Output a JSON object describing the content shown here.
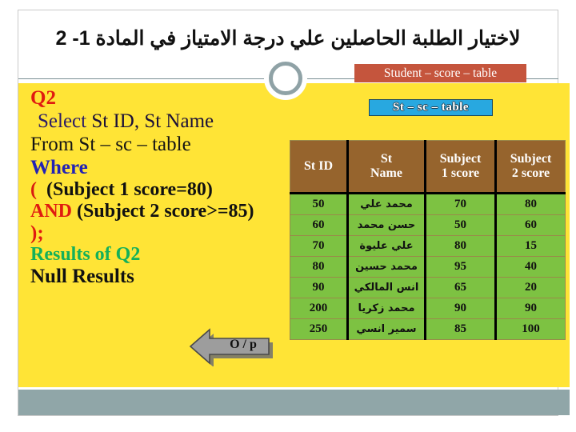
{
  "header": {
    "title_ar": "لاختيار الطلبة الحاصلين علي درجة الامتياز في المادة 1- 2",
    "student_badge": "Student – score – table",
    "ring_icon": "circle-ring-icon"
  },
  "sql": {
    "question_label": "Q2",
    "line_select_kw": "Select",
    "line_select_cols": " St ID, St Name",
    "line_from": "From St – sc – table",
    "line_where": "Where",
    "cond_open_paren": "(",
    "cond1": "(Subject 1 score=80)",
    "and_kw": "AND",
    "cond2": "(Subject 2 score>=85)",
    "close_stmt": ");",
    "results_label": "Results of Q2",
    "results_value": "Null Results"
  },
  "arrow": {
    "label": "O / p",
    "icon": "left-arrow-icon"
  },
  "table": {
    "badge": "St – sc – table",
    "columns": [
      "St ID",
      "St\nName",
      "Subject\n1 score",
      "Subject\n2 score"
    ],
    "columns_flat": [
      "St ID",
      "St Name",
      "Subject 1 score",
      "Subject 2 score"
    ],
    "rows": [
      {
        "st_id": "50",
        "st_name": "محمد علي",
        "subject1": "70",
        "subject2": "80"
      },
      {
        "st_id": "60",
        "st_name": "حسن محمد",
        "subject1": "50",
        "subject2": "60"
      },
      {
        "st_id": "70",
        "st_name": "علي عليوة",
        "subject1": "80",
        "subject2": "15"
      },
      {
        "st_id": "80",
        "st_name": "محمد حسين",
        "subject1": "95",
        "subject2": "40"
      },
      {
        "st_id": "90",
        "st_name": "انس المالكي",
        "subject1": "65",
        "subject2": "20"
      },
      {
        "st_id": "200",
        "st_name": "محمد زكريا",
        "subject1": "90",
        "subject2": "90"
      },
      {
        "st_id": "250",
        "st_name": "سمير انسي",
        "subject1": "85",
        "subject2": "100"
      }
    ]
  },
  "colors": {
    "panel_yellow": "#FFE436",
    "badge_red": "#C5553D",
    "badge_blue": "#28A8E0",
    "table_header_brown": "#96642D",
    "table_row_green": "#7DC242",
    "footer_gray": "#90A6A8",
    "accent_red": "#E01B10",
    "accent_blue": "#2222B5",
    "accent_green": "#14B05A"
  }
}
